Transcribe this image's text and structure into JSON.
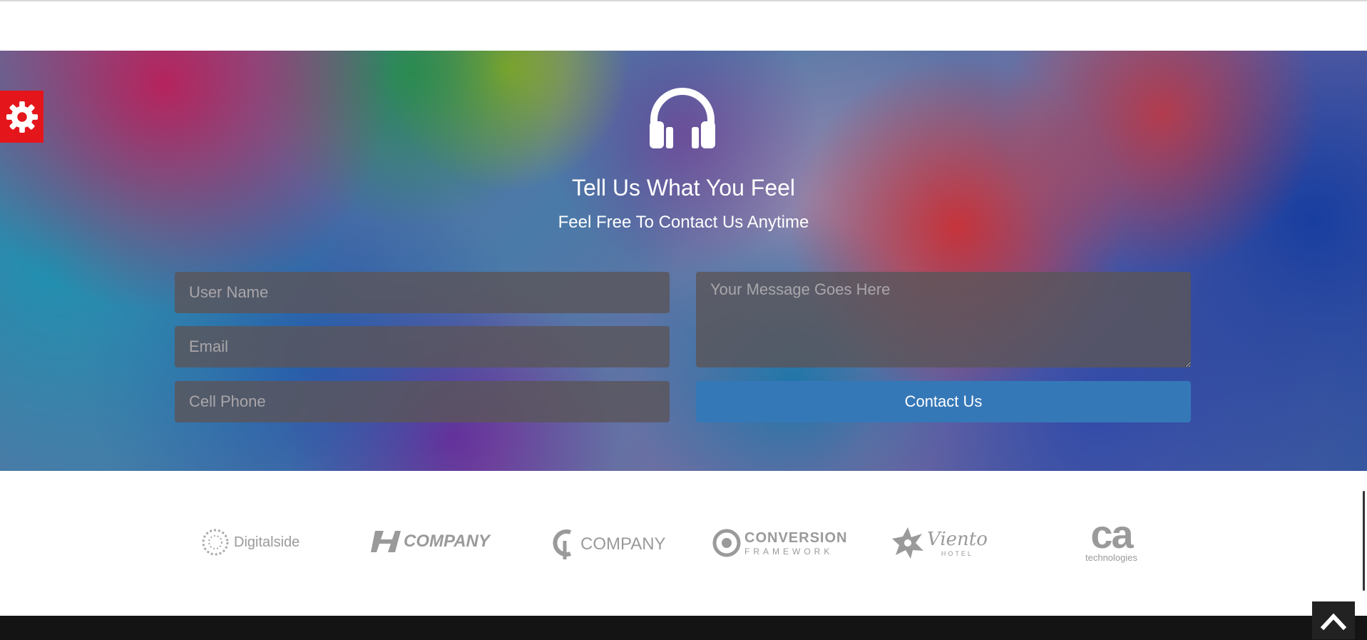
{
  "contact": {
    "title": "Tell Us What You Feel",
    "subtitle": "Feel Free To Contact Us Anytime",
    "fields": {
      "username_placeholder": "User Name",
      "email_placeholder": "Email",
      "phone_placeholder": "Cell Phone",
      "message_placeholder": "Your Message Goes Here"
    },
    "submit_label": "Contact Us",
    "submit_color": "#3578b8"
  },
  "settings": {
    "icon": "gear-icon",
    "color": "#e4161c"
  },
  "logos": [
    {
      "name": "digitalside",
      "label": "Digitalside"
    },
    {
      "name": "company-one",
      "label": "COMPANY"
    },
    {
      "name": "company-two",
      "label": "COMPANY"
    },
    {
      "name": "conversion-framework",
      "label": "CONVERSION",
      "sub": "FRAMEWORK"
    },
    {
      "name": "viento-hotel",
      "label": "Viento",
      "sub": "HOTEL"
    },
    {
      "name": "ca-technologies",
      "label": "ca",
      "sub": "technologies"
    }
  ],
  "scroll_top": {
    "icon": "chevron-up-icon"
  }
}
